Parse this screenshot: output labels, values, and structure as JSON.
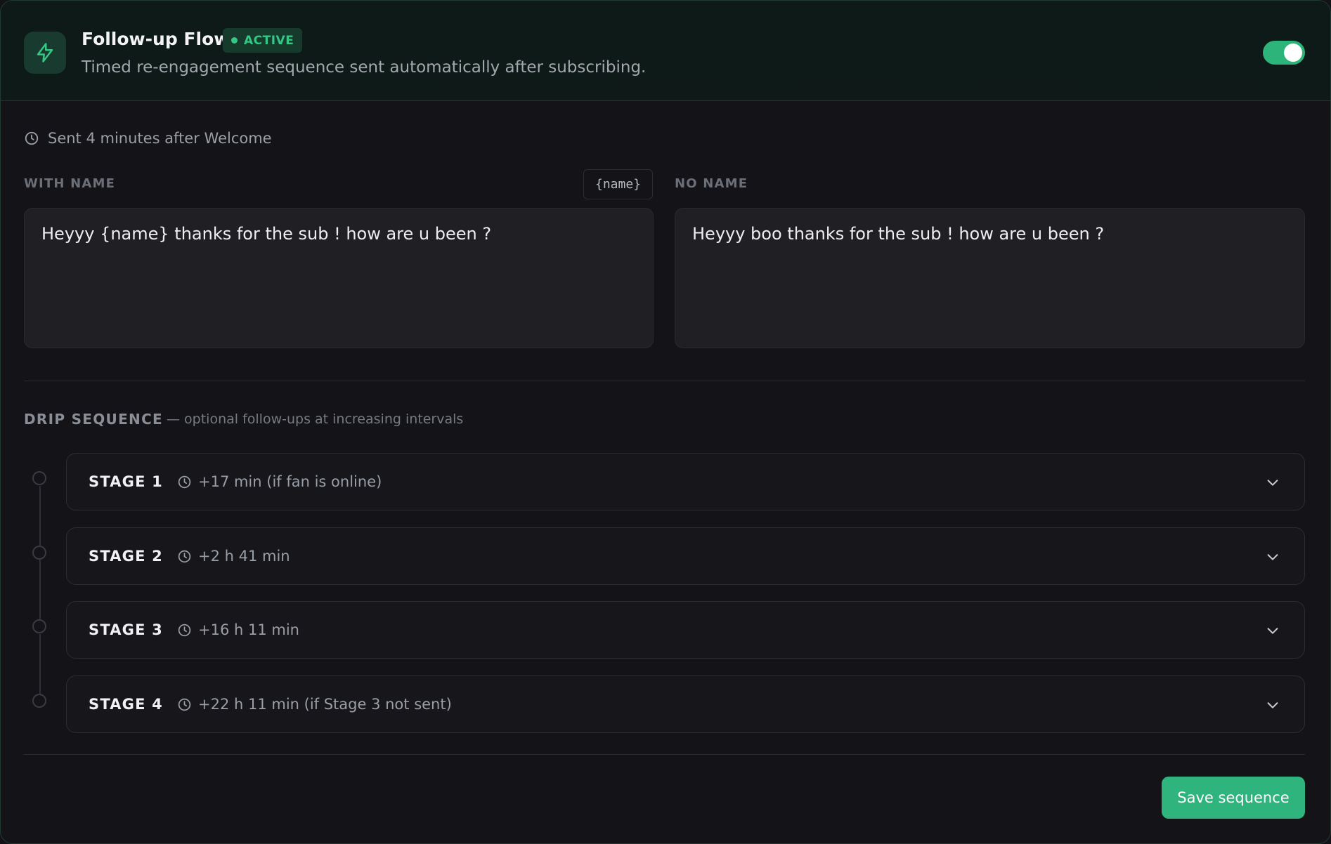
{
  "header": {
    "title": "Follow-up Flow",
    "status_badge": "ACTIVE",
    "description": "Timed re-engagement sequence sent automatically after subscribing.",
    "icon": "lightning-icon",
    "toggle_on": true
  },
  "timing": {
    "text": "Sent 4 minutes after Welcome",
    "icon": "clock-icon"
  },
  "with_name": {
    "label": "WITH NAME",
    "token": "{name}",
    "message": "Heyyy {name} thanks for the sub ! how are u been ?"
  },
  "no_name": {
    "label": "NO NAME",
    "message": "Heyyy boo thanks for the sub ! how are u been ?"
  },
  "drip": {
    "title": "DRIP SEQUENCE",
    "subtitle": "— optional follow-ups at increasing intervals",
    "stages": [
      {
        "name": "STAGE 1",
        "delay": "+17 min (if fan is online)"
      },
      {
        "name": "STAGE 2",
        "delay": "+2 h 41 min"
      },
      {
        "name": "STAGE 3",
        "delay": "+16 h 11 min"
      },
      {
        "name": "STAGE 4",
        "delay": "+22 h 11 min (if Stage 3 not sent)"
      }
    ]
  },
  "actions": {
    "save_label": "Save sequence"
  },
  "colors": {
    "accent": "#2eb47c",
    "active_text": "#34c785",
    "background": "#141418"
  }
}
